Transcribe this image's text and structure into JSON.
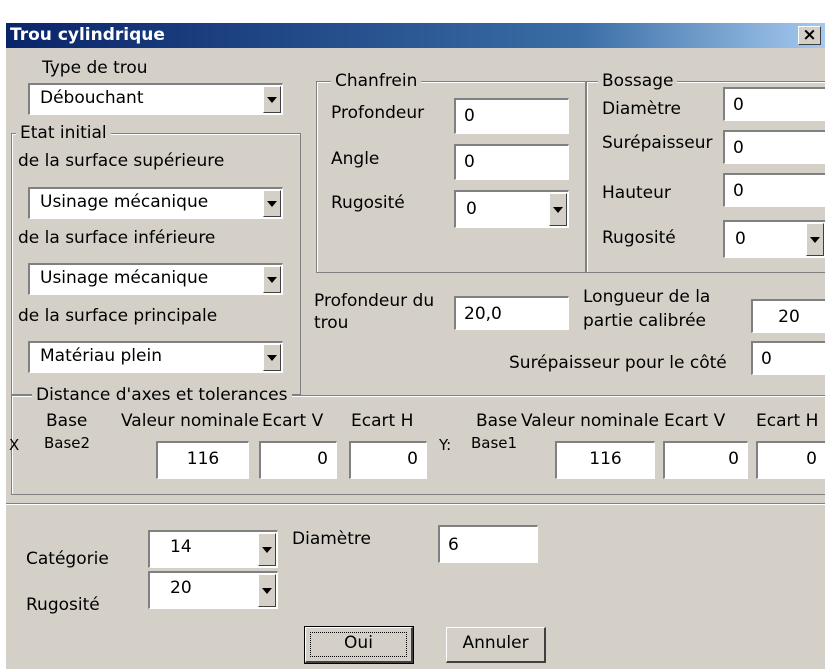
{
  "window": {
    "title": "Trou cylindrique",
    "close_label": "×"
  },
  "type_trou": {
    "label": "Type de trou",
    "value": "Débouchant"
  },
  "etat_initial": {
    "legend": "Etat initial",
    "sup_label": "de la surface supérieure",
    "sup_value": "Usinage mécanique",
    "inf_label": "de la surface inférieure",
    "inf_value": "Usinage mécanique",
    "princ_label": "de la surface principale",
    "princ_value": "Matériau plein"
  },
  "chanfrein": {
    "legend": "Chanfrein",
    "profondeur_label": "Profondeur",
    "profondeur_value": "0",
    "angle_label": "Angle",
    "angle_value": "0",
    "rugosite_label": "Rugosité",
    "rugosite_value": "0"
  },
  "bossage": {
    "legend": "Bossage",
    "diametre_label": "Diamètre",
    "diametre_value": "0",
    "surep_label": "Surépaisseur",
    "surep_value": "0",
    "hauteur_label": "Hauteur",
    "hauteur_value": "0",
    "rugosite_label": "Rugosité",
    "rugosite_value": "0"
  },
  "trou": {
    "profondeur_label_1": "Profondeur du",
    "profondeur_label_2": "trou",
    "profondeur_value": "20,0",
    "longueur_label_1": "Longueur de la",
    "longueur_label_2": "partie calibrée",
    "longueur_value": "20",
    "surep_cote_label": "Surépaisseur pour le côté",
    "surep_cote_value": "0"
  },
  "distance": {
    "legend": "Distance d'axes et tolerances",
    "x": {
      "base_header": "Base",
      "valeur_header": "Valeur nominale",
      "ecart_v_header": "Ecart V",
      "ecart_h_header": "Ecart H",
      "axis_label": "X",
      "base_value": "Base2",
      "valeur": "116",
      "ecart_v": "0",
      "ecart_h": "0"
    },
    "y": {
      "base_header": "Base",
      "valeur_header": "Valeur nominale",
      "ecart_v_header": "Ecart V",
      "ecart_h_header": "Ecart H",
      "axis_label": "Y:",
      "base_value": "Base1",
      "valeur": "116",
      "ecart_v": "0",
      "ecart_h": "0"
    }
  },
  "bottom": {
    "categorie_label": "Catégorie",
    "categorie_value": "14",
    "diametre_label": "Diamètre",
    "diametre_value": "6",
    "rugosite_label": "Rugosité",
    "rugosite_value": "20"
  },
  "buttons": {
    "ok": "Oui",
    "cancel": "Annuler"
  }
}
